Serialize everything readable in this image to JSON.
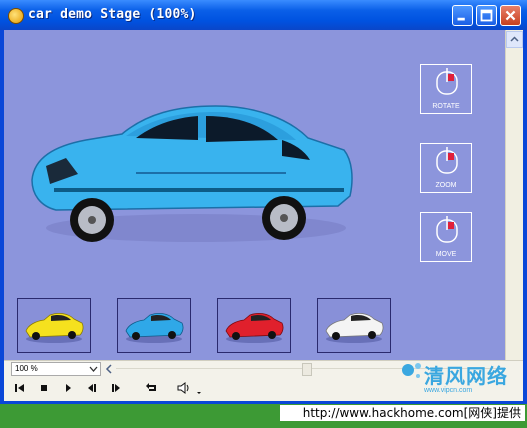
{
  "window": {
    "title": "car demo Stage (100%)",
    "buttons": {
      "minimize": "minimize",
      "maximize": "maximize",
      "close": "close"
    }
  },
  "stage": {
    "controls": [
      {
        "label": "ROTATE",
        "icon": "mouse-icon"
      },
      {
        "label": "ZOOM",
        "icon": "mouse-icon"
      },
      {
        "label": "MOVE",
        "icon": "mouse-icon"
      }
    ],
    "thumbnails": [
      {
        "name": "yellow-car",
        "color": "#f5e11e"
      },
      {
        "name": "blue-car",
        "color": "#2fa8e8"
      },
      {
        "name": "red-car",
        "color": "#e0202c"
      },
      {
        "name": "white-car",
        "color": "#f4f4f4"
      }
    ],
    "main_car_color": "#39b3ee",
    "background_color": "#8c95dc"
  },
  "player": {
    "zoom_value": "100 %",
    "buttons": [
      "rewind",
      "stop",
      "play",
      "step-back",
      "step-forward",
      "loop",
      "volume"
    ]
  },
  "watermark": {
    "brand": "清风网络",
    "url": "www.vipcn.com"
  },
  "footer": {
    "text": "http://www.hackhome.com[网侠]提供"
  }
}
